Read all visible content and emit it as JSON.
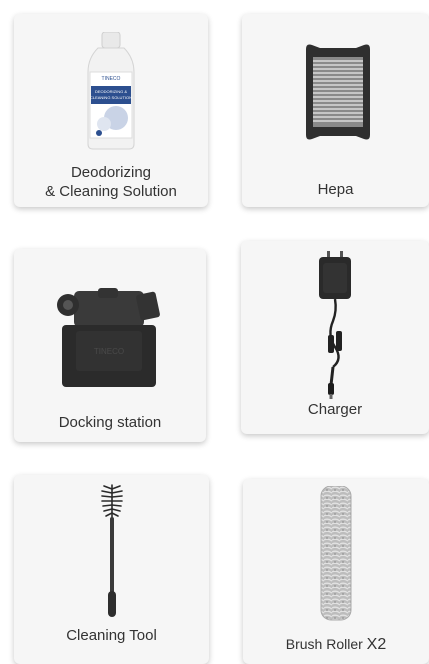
{
  "items": [
    {
      "line1": "Deodorizing",
      "line2": "& Cleaning Solution",
      "icon": "cleaning-solution-bottle-icon"
    },
    {
      "label": "Hepa",
      "icon": "hepa-filter-icon"
    },
    {
      "label": "Docking station",
      "icon": "docking-station-icon"
    },
    {
      "label": "Charger",
      "icon": "charger-adapter-icon"
    },
    {
      "label": "Cleaning Tool",
      "icon": "cleaning-brush-tool-icon"
    },
    {
      "label": "Brush Roller",
      "qty": "X2",
      "icon": "brush-roller-icon"
    }
  ],
  "bottle_brand": "TINECO",
  "bottle_text": "DEODORIZING & CLEANING SOLUTION",
  "dock_brand": "TINECO",
  "colors": {
    "card_bg": "#f6f6f6",
    "text": "#333333",
    "product_dark": "#2b2b2b"
  }
}
